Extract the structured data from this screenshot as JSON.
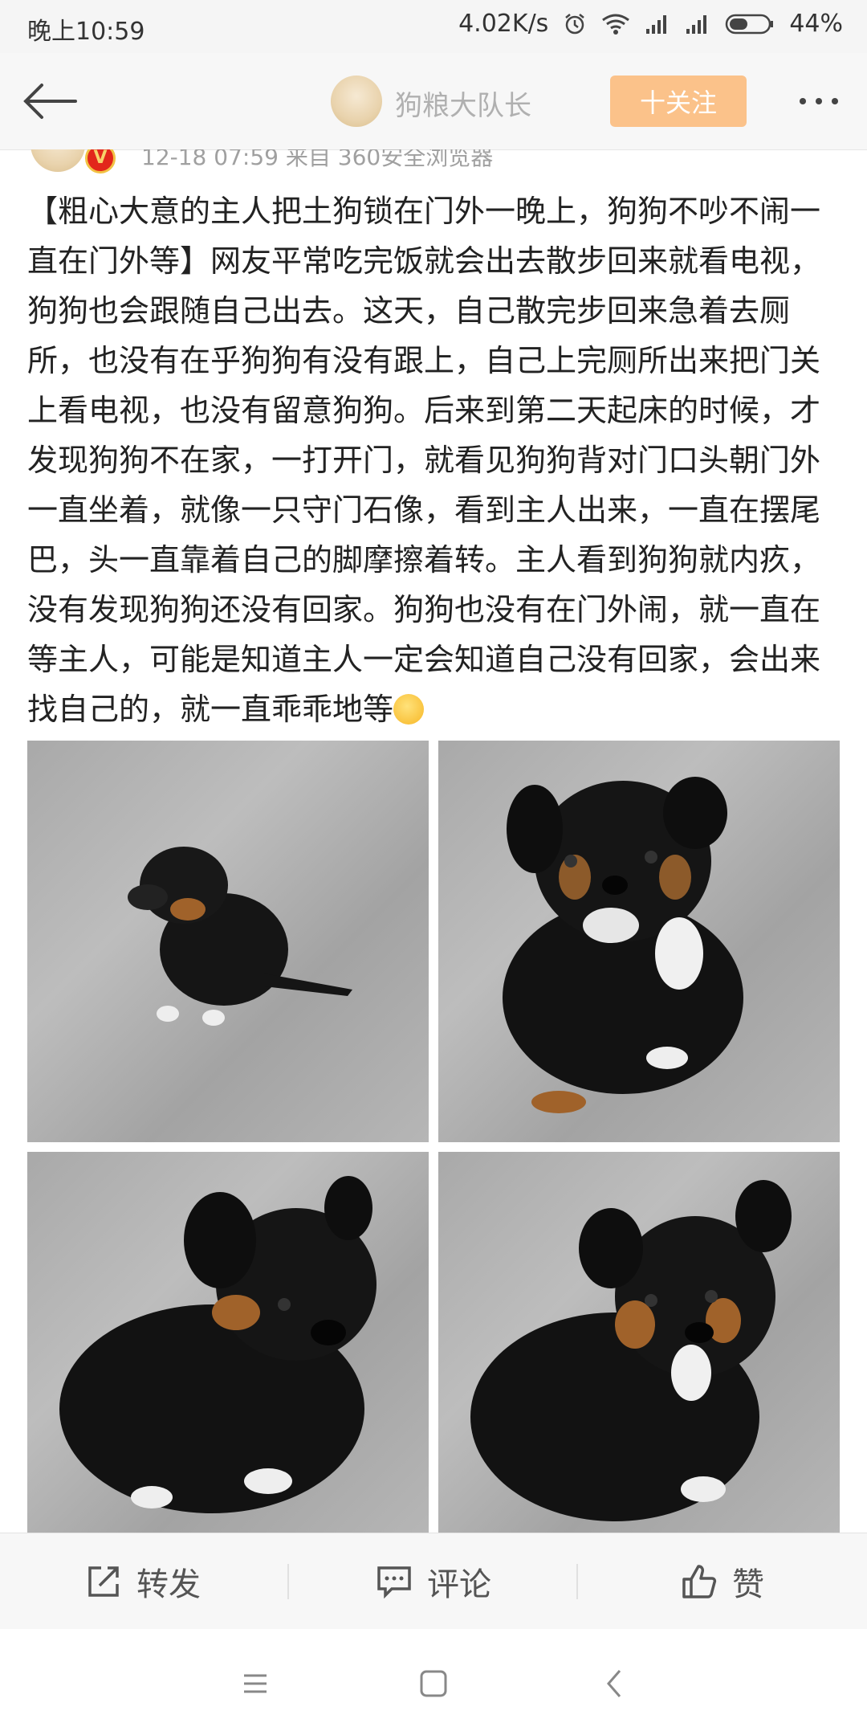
{
  "status_bar": {
    "time": "晚上10:59",
    "speed": "4.02K/s",
    "battery": "44%",
    "icons": [
      "alarm-icon",
      "wifi-icon",
      "signal-icon",
      "signal-icon",
      "battery-icon"
    ]
  },
  "nav": {
    "back_icon": "back-arrow-icon",
    "title": "狗粮大队长",
    "follow_label": "十关注",
    "more_icon": "more-dots-icon"
  },
  "post": {
    "time_source": "12-18 07:59   来自 360安全浏览器",
    "text": "【粗心大意的主人把土狗锁在门外一晚上，狗狗不吵不闹一直在门外等】网友平常吃完饭就会出去散步回来就看电视，狗狗也会跟随自己出去。这天，自己散完步回来急着去厕所，也没有在乎狗狗有没有跟上，自己上完厕所出来把门关上看电视，也没有留意狗狗。后来到第二天起床的时候，才发现狗狗不在家，一打开门，就看见狗狗背对门口头朝门外一直坐着，就像一只守门石像，看到主人出来，一直在摆尾巴，头一直靠着自己的脚摩擦着转。主人看到狗狗就内疚，没有发现狗狗还没有回家。狗狗也没有在门外闹，就一直在等主人，可能是知道主人一定会知道自己没有回家，会出来找自己的，就一直乖乖地等",
    "emoji": "smile-emoji",
    "photos": [
      "puppy-photo-1",
      "puppy-photo-2",
      "puppy-photo-3",
      "puppy-photo-4"
    ]
  },
  "actions": {
    "repost": "转发",
    "comment": "评论",
    "like": "赞"
  },
  "colors": {
    "follow_button": "#fbc28a",
    "vip_badge": "#e2271b",
    "text": "#222222"
  }
}
